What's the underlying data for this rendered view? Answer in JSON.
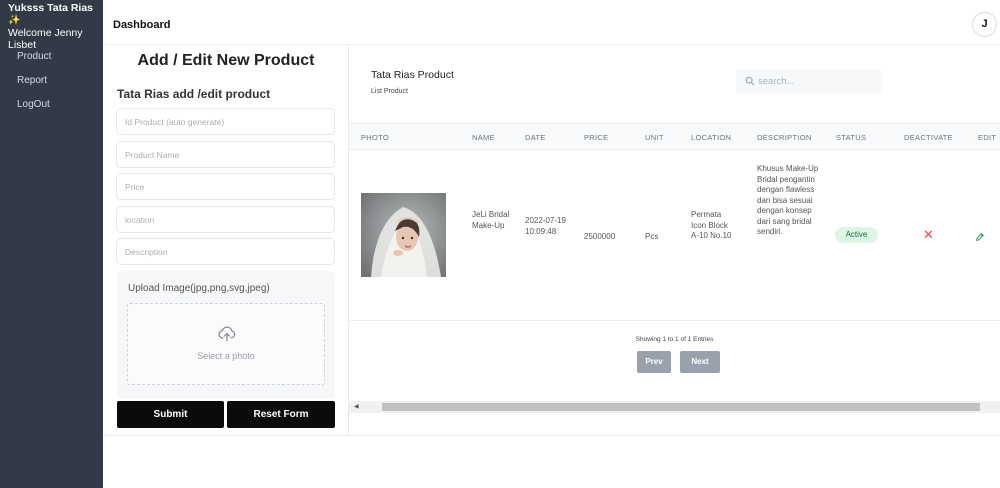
{
  "sidebar": {
    "brand": "Yuksss Tata Rias",
    "brand_icon": "sparkle-icon",
    "welcome": "Welcome Jenny Lisbet",
    "items": [
      {
        "label": "Product"
      },
      {
        "label": "Report"
      },
      {
        "label": "LogOut"
      }
    ]
  },
  "header": {
    "title": "Dashboard",
    "avatar_letter": "J"
  },
  "form": {
    "title": "Add / Edit New Product",
    "subtitle": "Tata Rias add /edit product",
    "fields": {
      "id_placeholder": "Id Product (auto generate)",
      "name_placeholder": "Product Name",
      "price_placeholder": "Price",
      "location_placeholder": "location",
      "description_placeholder": "Description"
    },
    "upload_label": "Upload Image(jpg,png,svg,jpeg)",
    "upload_icon": "cloud-upload-icon",
    "select_photo": "Select a photo",
    "submit_label": "Submit",
    "reset_label": "Reset Form"
  },
  "table": {
    "title": "Tata Rias Product",
    "subtitle": "List Product",
    "search_placeholder": "search...",
    "search_icon": "search-icon",
    "headers": [
      "PHOTO",
      "NAME",
      "DATE",
      "PRICE",
      "UNIT",
      "LOCATION",
      "DESCRIPTION",
      "STATUS",
      "DEACTIVATE",
      "EDIT"
    ],
    "rows": [
      {
        "photo": "bride-photo",
        "name": "JeLi Bridal Make-Up",
        "date": "2022-07-19 10:09:48",
        "price": "2500000",
        "unit": "Pcs",
        "location": "Permata Icon Block A-10 No.10",
        "description": "Khusus Make-Up Bridal pengantin dengan flawless dan bisa sesuai dengan konsep dari sang bridal sendiri.",
        "status": "Active",
        "deactivate_icon": "close-icon",
        "edit_icon": "pencil-icon"
      }
    ],
    "showing": "Showing 1 to 1 of 1 Entries",
    "prev_label": "Prev",
    "next_label": "Next"
  },
  "colors": {
    "sidebar_bg": "#323a48",
    "button_dark": "#0b0b0b",
    "status_active_bg": "#dcf5e4",
    "status_active_text": "#1f6f3a",
    "deactivate": "#ef4444",
    "edit": "#22a05a"
  }
}
